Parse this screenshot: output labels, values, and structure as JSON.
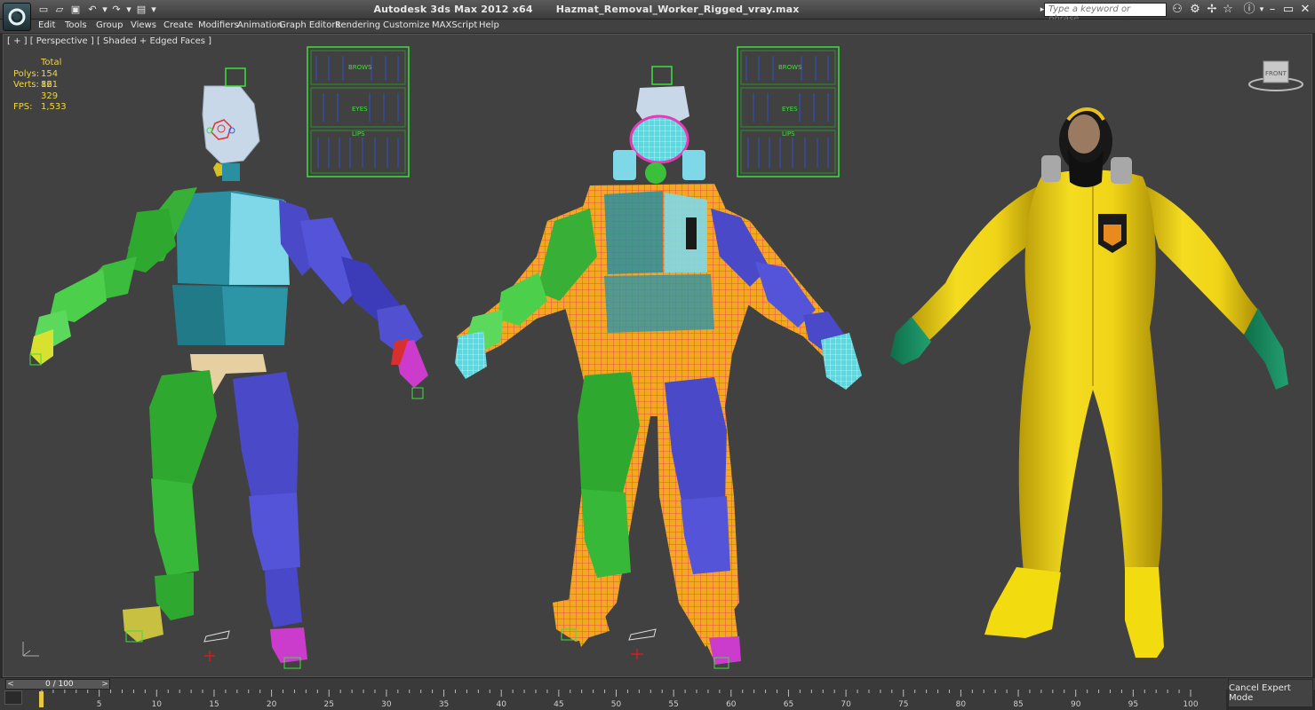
{
  "window": {
    "app_title": "Autodesk 3ds Max  2012 x64",
    "file_title": "Hazmat_Removal_Worker_Rigged_vray.max",
    "search_placeholder": "Type a keyword or phrase"
  },
  "menu": [
    "Edit",
    "Tools",
    "Group",
    "Views",
    "Create",
    "Modifiers",
    "Animation",
    "Graph Editors",
    "Rendering",
    "Customize",
    "MAXScript",
    "Help"
  ],
  "viewport": {
    "label": "[ + ] [ Perspective ] [ Shaded + Edged Faces ]",
    "stats": {
      "header": "Total",
      "polys_label": "Polys:",
      "polys": "154 121",
      "verts_label": "Verts:",
      "verts": "86 329",
      "fps_label": "FPS:",
      "fps": "1,533"
    },
    "viewcube_label": "FRONT",
    "face_panel_labels": [
      "BROWS",
      "EYES",
      "LIPS"
    ]
  },
  "timeline": {
    "slider_value": "0 / 100",
    "ticks": [
      5,
      10,
      15,
      20,
      25,
      30,
      35,
      40,
      45,
      50,
      55,
      60,
      65,
      70,
      75,
      80,
      85,
      90,
      95,
      100
    ],
    "cancel_expert_label": "Cancel Expert Mode"
  },
  "colors": {
    "viewport_bg": "#414141",
    "stats_yellow": "#f2d63c",
    "rig_green": "#2fa82f",
    "rig_blue": "#4a4ac8",
    "rig_teal": "#2a8fa0",
    "suit_yellow": "#f0d81c"
  }
}
